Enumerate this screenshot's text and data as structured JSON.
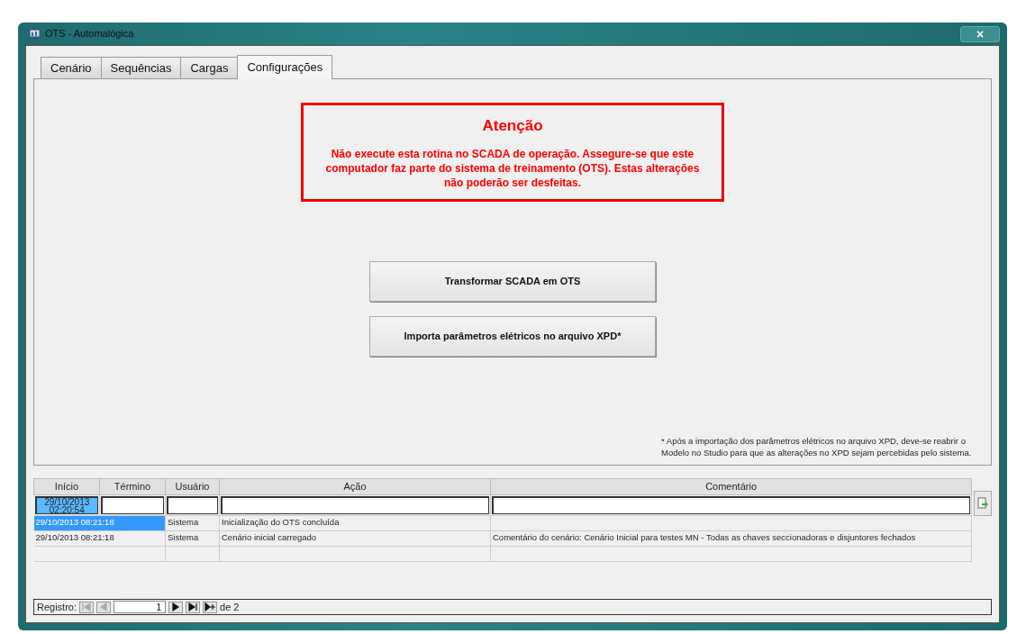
{
  "window": {
    "title": "OTS - Automalógica",
    "close": "×"
  },
  "tabs": [
    {
      "label": "Cenário",
      "selected": false
    },
    {
      "label": "Sequências",
      "selected": false
    },
    {
      "label": "Cargas",
      "selected": false
    },
    {
      "label": "Configurações",
      "selected": true
    }
  ],
  "warning": {
    "title": "Atenção",
    "message": "Não execute esta rotina no SCADA de operação. Assegure-se que este computador faz parte do sistema de treinamento (OTS). Estas alterações não poderão ser desfeitas."
  },
  "actions": [
    "Transformar SCADA em OTS",
    "Importa parâmetros elétricos no arquivo XPD*"
  ],
  "footnote": "* Após a importação dos parâmetros elétricos no arquivo XPD, deve-se reabrir o Modelo no Studio para que as alterações no XPD sejam percebidas pelo sistema.",
  "log": {
    "columns": [
      "Início",
      "Término",
      "Usuário",
      "Ação",
      "Comentário"
    ],
    "start_filter": "29/10/2013 02:20:54",
    "rows": [
      {
        "time": "29/10/2013 08:21:18",
        "user": "Sistema",
        "action": "Inicialização do OTS concluída",
        "selected": true
      },
      {
        "time": "29/10/2013 08:21:18",
        "user": "Sistema",
        "action": "Cenário inicial carregado",
        "comment": "Comentário do cenário: Cenário Inicial para testes MN - Todas as chaves seccionadoras e disjuntores fechados",
        "selected": false
      }
    ]
  },
  "navigator": {
    "label": "Registro:",
    "current": "1",
    "total": "de 2",
    "buttons": [
      {
        "kind": "first",
        "disabled": true
      },
      {
        "kind": "prev",
        "disabled": true
      },
      {
        "kind": "next",
        "disabled": false
      },
      {
        "kind": "last",
        "disabled": false
      },
      {
        "kind": "new",
        "disabled": false
      }
    ]
  }
}
